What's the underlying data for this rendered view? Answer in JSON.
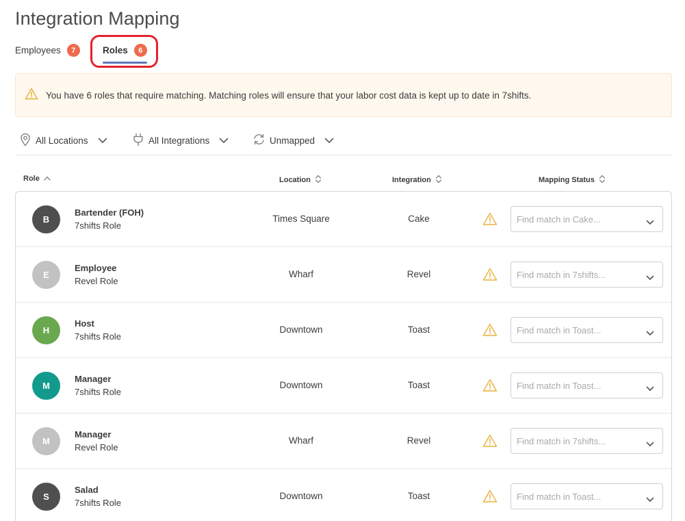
{
  "page": {
    "title": "Integration Mapping"
  },
  "tabs": [
    {
      "label": "Employees",
      "count": "7"
    },
    {
      "label": "Roles",
      "count": "6"
    }
  ],
  "alert": {
    "text": "You have 6 roles that require matching. Matching roles will ensure that your labor cost data is kept up to date in 7shifts."
  },
  "filters": {
    "location": "All Locations",
    "integration": "All Integrations",
    "status": "Unmapped"
  },
  "columns": {
    "role": "Role",
    "location": "Location",
    "integration": "Integration",
    "mapping_status": "Mapping Status"
  },
  "rows": [
    {
      "initial": "B",
      "avatar_color": "#4f4f4f",
      "name": "Bartender (FOH)",
      "type": "7shifts Role",
      "location": "Times Square",
      "integration": "Cake",
      "placeholder": "Find match in Cake..."
    },
    {
      "initial": "E",
      "avatar_color": "#c2c2c2",
      "name": "Employee",
      "type": "Revel Role",
      "location": "Wharf",
      "integration": "Revel",
      "placeholder": "Find match in 7shifts..."
    },
    {
      "initial": "H",
      "avatar_color": "#6aa84f",
      "name": "Host",
      "type": "7shifts Role",
      "location": "Downtown",
      "integration": "Toast",
      "placeholder": "Find match in Toast..."
    },
    {
      "initial": "M",
      "avatar_color": "#129a8c",
      "name": "Manager",
      "type": "7shifts Role",
      "location": "Downtown",
      "integration": "Toast",
      "placeholder": "Find match in Toast..."
    },
    {
      "initial": "M",
      "avatar_color": "#c2c2c2",
      "name": "Manager",
      "type": "Revel Role",
      "location": "Wharf",
      "integration": "Revel",
      "placeholder": "Find match in 7shifts..."
    },
    {
      "initial": "S",
      "avatar_color": "#4f4f4f",
      "name": "Salad",
      "type": "7shifts Role",
      "location": "Downtown",
      "integration": "Toast",
      "placeholder": "Find match in Toast..."
    }
  ],
  "colors": {
    "badge": "#ef6a4e",
    "active_tab_underline": "#5a78b8",
    "highlight_ring": "#e4222b",
    "warning": "#e8b13c",
    "alert_bg": "#fff8ee"
  },
  "icons": {
    "alert": "warning-icon",
    "location": "location-pin-icon",
    "integration": "plug-icon",
    "status": "refresh-icon",
    "row_status": "warning-icon",
    "dropdown": "chevron-down-icon"
  }
}
